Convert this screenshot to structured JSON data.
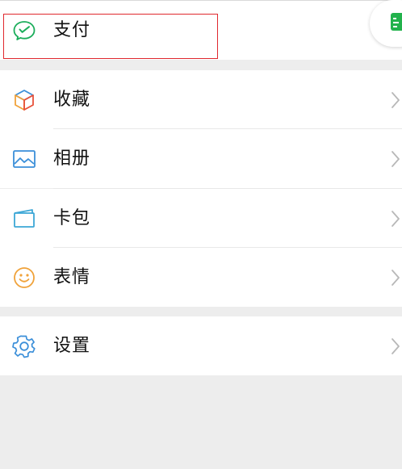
{
  "menu": {
    "pay": {
      "label": "支付",
      "icon": "wechat-pay-icon"
    },
    "favorites": {
      "label": "收藏",
      "icon": "cube-icon"
    },
    "album": {
      "label": "相册",
      "icon": "picture-icon"
    },
    "cards": {
      "label": "卡包",
      "icon": "wallet-icon"
    },
    "stickers": {
      "label": "表情",
      "icon": "smiley-icon"
    },
    "settings": {
      "label": "设置",
      "icon": "gear-icon"
    }
  },
  "colors": {
    "background": "#ededed",
    "row": "#ffffff",
    "pay_green": "#1aad5a",
    "album_blue": "#3b8fd9",
    "cards_blue": "#3da7d6",
    "smiley_orange": "#f0a23a",
    "settings_blue": "#3b8fd9",
    "highlight_red": "#e0282e",
    "float_green": "#22b24c"
  }
}
